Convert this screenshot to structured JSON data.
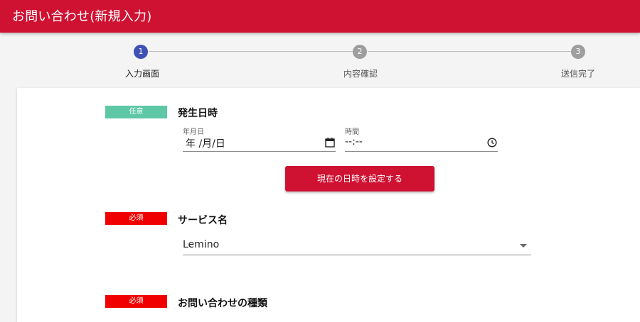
{
  "header": {
    "title": "お問い合わせ(新規入力)"
  },
  "stepper": {
    "steps": [
      {
        "number": "1",
        "label": "入力画面",
        "active": true
      },
      {
        "number": "2",
        "label": "内容確認",
        "active": false
      },
      {
        "number": "3",
        "label": "送信完了",
        "active": false
      }
    ]
  },
  "form": {
    "occurrence": {
      "badge": "任意",
      "title": "発生日時",
      "date": {
        "caption": "年月日",
        "value": "年 /月/日"
      },
      "time": {
        "caption": "時間",
        "value": "--:--"
      },
      "set_now_button": "現在の日時を設定する"
    },
    "service": {
      "badge": "必須",
      "title": "サービス名",
      "selected": "Lemino"
    },
    "inquiry_type": {
      "badge": "必須",
      "title": "お問い合わせの種類"
    }
  },
  "colors": {
    "brand": "#cf1132",
    "active_step": "#3f51b5",
    "optional_badge": "#5ec7a6",
    "required_badge": "#f00000"
  }
}
